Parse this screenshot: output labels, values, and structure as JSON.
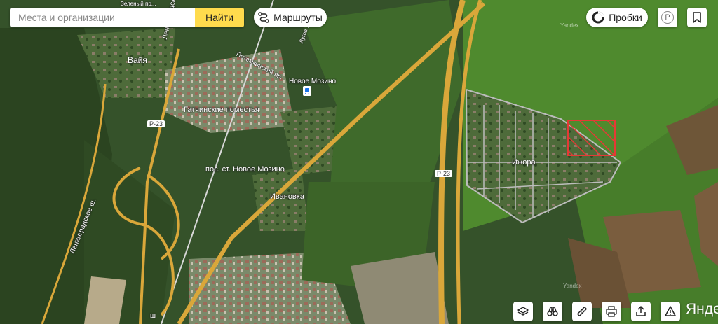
{
  "search": {
    "placeholder": "Места и организации",
    "button_label": "Найти"
  },
  "toolbar": {
    "routes_label": "Маршруты",
    "traffic_label": "Пробки",
    "parking_letter": "P",
    "logo_text": "Яндекс"
  },
  "map": {
    "places": {
      "vaya": "Вайя",
      "gatchina_estates": "Гатчинские поместья",
      "new_mozino_station": "Новое Мозино",
      "new_mozino_settlement": "пос. ст. Новое Мозино",
      "ivanovka": "Ивановка",
      "izhora": "Ижора"
    },
    "streets": {
      "leningradskaya": "Ленинградская",
      "potemkinsky": "Потемкинский пр.",
      "leningradskoe_sh": "Ленинградское ш.",
      "partial_top": "Зеленый пр...",
      "partial_right": "Лугов...",
      "partial_bottom": "ш"
    },
    "road_badges": [
      "Р-23",
      "Р-23"
    ],
    "watermark": "Yandex"
  },
  "colors": {
    "accent": "#ffdb4d",
    "highway": "#d9a73a",
    "marker_red": "#e53935",
    "forest": "#2f4a23",
    "field": "#4f8a2e"
  },
  "icons": [
    "route-icon",
    "traffic-icon",
    "parking-icon",
    "bookmark-icon",
    "layers-icon",
    "binoculars-icon",
    "ruler-icon",
    "print-icon",
    "share-icon",
    "warning-icon"
  ]
}
